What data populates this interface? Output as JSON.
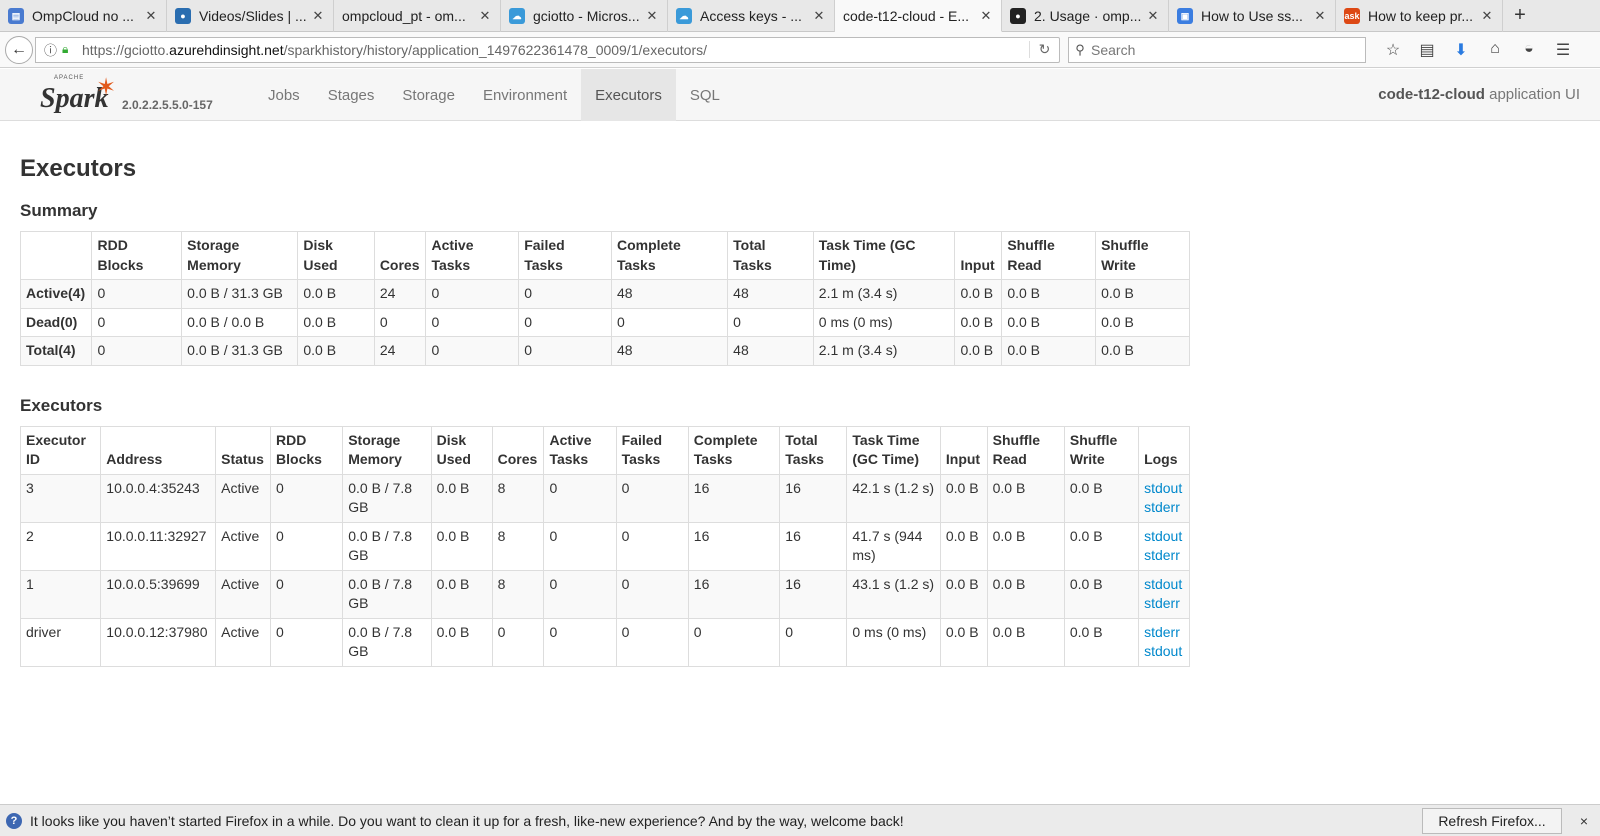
{
  "browser": {
    "tabs": [
      {
        "title": "OmpCloud no ...",
        "icon": "doc-favicon-icon",
        "color": "#4a7bd0",
        "glyph": "▤"
      },
      {
        "title": "Videos/Slides | ...",
        "icon": "drupal-favicon-icon",
        "color": "#2a6db0",
        "glyph": "●"
      },
      {
        "title": "ompcloud_pt - om...",
        "icon": "",
        "color": "",
        "glyph": ""
      },
      {
        "title": "gciotto - Micros...",
        "icon": "azure-cloud-icon",
        "color": "#3a9ad9",
        "glyph": "☁"
      },
      {
        "title": "Access keys - ...",
        "icon": "azure-cloud-icon",
        "color": "#3a9ad9",
        "glyph": "☁"
      },
      {
        "title": "code-t12-cloud - E...",
        "icon": "",
        "color": "",
        "glyph": ""
      },
      {
        "title": "2. Usage · omp...",
        "icon": "github-icon",
        "color": "#222",
        "glyph": "●"
      },
      {
        "title": "How to Use ss...",
        "icon": "bookmark-favicon-icon",
        "color": "#3b7de0",
        "glyph": "▣"
      },
      {
        "title": "How to keep pr...",
        "icon": "askubuntu-icon",
        "color": "#dd4814",
        "glyph": "ask"
      }
    ],
    "active_tab": 5,
    "new_tab_label": "+",
    "url_prefix": "https://gciotto.",
    "url_domain": "azurehdinsight.net",
    "url_path": "/sparkhistory/history/application_1497622361478_0009/1/executors/",
    "search_placeholder": "Search"
  },
  "spark": {
    "logo_word": "Spark",
    "logo_apache": "APACHE",
    "version": "2.0.2.2.5.5.0-157",
    "nav": [
      "Jobs",
      "Stages",
      "Storage",
      "Environment",
      "Executors",
      "SQL"
    ],
    "active_nav": 4,
    "app_name": "code-t12-cloud",
    "app_suffix": " application UI"
  },
  "page": {
    "title": "Executors",
    "summary_heading": "Summary",
    "executors_heading": "Executors"
  },
  "summary": {
    "headers": [
      "",
      "RDD Blocks",
      "Storage Memory",
      "Disk Used",
      "Cores",
      "Active Tasks",
      "Failed Tasks",
      "Complete Tasks",
      "Total Tasks",
      "Task Time (GC Time)",
      "Input",
      "Shuffle Read",
      "Shuffle Write"
    ],
    "rows": [
      [
        "Active(4)",
        "0",
        "0.0 B / 31.3 GB",
        "0.0 B",
        "24",
        "0",
        "0",
        "48",
        "48",
        "2.1 m (3.4 s)",
        "0.0 B",
        "0.0 B",
        "0.0 B"
      ],
      [
        "Dead(0)",
        "0",
        "0.0 B / 0.0 B",
        "0.0 B",
        "0",
        "0",
        "0",
        "0",
        "0",
        "0 ms (0 ms)",
        "0.0 B",
        "0.0 B",
        "0.0 B"
      ],
      [
        "Total(4)",
        "0",
        "0.0 B / 31.3 GB",
        "0.0 B",
        "24",
        "0",
        "0",
        "48",
        "48",
        "2.1 m (3.4 s)",
        "0.0 B",
        "0.0 B",
        "0.0 B"
      ]
    ]
  },
  "executors": {
    "headers": [
      "Executor ID",
      "Address",
      "Status",
      "RDD Blocks",
      "Storage Memory",
      "Disk Used",
      "Cores",
      "Active Tasks",
      "Failed Tasks",
      "Complete Tasks",
      "Total Tasks",
      "Task Time (GC Time)",
      "Input",
      "Shuffle Read",
      "Shuffle Write",
      "Logs"
    ],
    "rows": [
      {
        "cells": [
          "3",
          "10.0.0.4:35243",
          "Active",
          "0",
          "0.0 B / 7.8 GB",
          "0.0 B",
          "8",
          "0",
          "0",
          "16",
          "16",
          "42.1 s (1.2 s)",
          "0.0 B",
          "0.0 B",
          "0.0 B"
        ],
        "logs": [
          "stdout",
          "stderr"
        ]
      },
      {
        "cells": [
          "2",
          "10.0.0.11:32927",
          "Active",
          "0",
          "0.0 B / 7.8 GB",
          "0.0 B",
          "8",
          "0",
          "0",
          "16",
          "16",
          "41.7 s (944 ms)",
          "0.0 B",
          "0.0 B",
          "0.0 B"
        ],
        "logs": [
          "stdout",
          "stderr"
        ]
      },
      {
        "cells": [
          "1",
          "10.0.0.5:39699",
          "Active",
          "0",
          "0.0 B / 7.8 GB",
          "0.0 B",
          "8",
          "0",
          "0",
          "16",
          "16",
          "43.1 s (1.2 s)",
          "0.0 B",
          "0.0 B",
          "0.0 B"
        ],
        "logs": [
          "stdout",
          "stderr"
        ]
      },
      {
        "cells": [
          "driver",
          "10.0.0.12:37980",
          "Active",
          "0",
          "0.0 B / 7.8 GB",
          "0.0 B",
          "0",
          "0",
          "0",
          "0",
          "0",
          "0 ms (0 ms)",
          "0.0 B",
          "0.0 B",
          "0.0 B"
        ],
        "logs": [
          "stderr",
          "stdout"
        ]
      }
    ]
  },
  "notification": {
    "message": "It looks like you haven’t started Firefox in a while. Do you want to clean it up for a fresh, like-new experience? And by the way, welcome back!",
    "button": "Refresh Firefox...",
    "close": "×"
  },
  "colors": {
    "link": "#0088cc",
    "spark_orange": "#e25a1c"
  }
}
